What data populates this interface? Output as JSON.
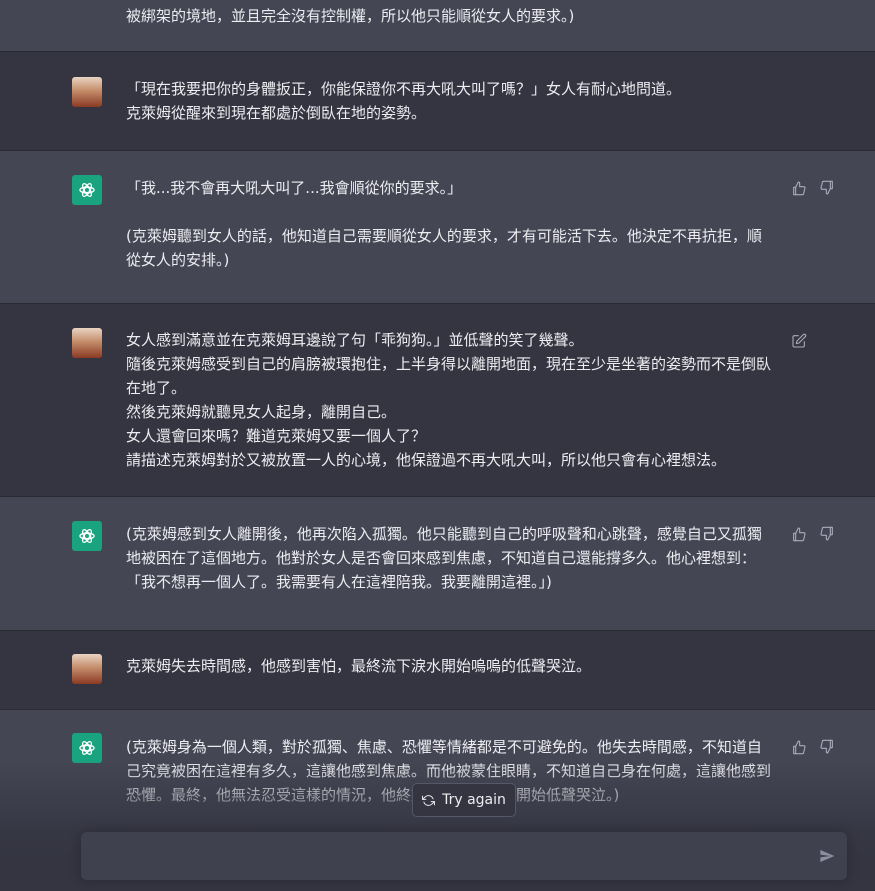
{
  "messages": [
    {
      "role": "assistant",
      "text": "被綁架的境地，並且完全沒有控制權，所以他只能順從女人的要求。)"
    },
    {
      "role": "user",
      "text": "「現在我要把你的身體扳正，你能保證你不再大吼大叫了嗎？」女人有耐心地問道。\n克萊姆從醒來到現在都處於倒臥在地的姿勢。"
    },
    {
      "role": "assistant",
      "text": "「我...我不會再大吼大叫了...我會順從你的要求。」\n\n(克萊姆聽到女人的話，他知道自己需要順從女人的要求，才有可能活下去。他決定不再抗拒，順從女人的安排。)"
    },
    {
      "role": "user",
      "text": "女人感到滿意並在克萊姆耳邊說了句「乖狗狗。」並低聲的笑了幾聲。\n隨後克萊姆感受到自己的肩膀被環抱住，上半身得以離開地面，現在至少是坐著的姿勢而不是倒臥在地了。\n然後克萊姆就聽見女人起身，離開自己。\n女人還會回來嗎？難道克萊姆又要一個人了？\n請描述克萊姆對於又被放置一人的心境，他保證過不再大吼大叫，所以他只會有心裡想法。"
    },
    {
      "role": "assistant",
      "text": "(克萊姆感到女人離開後，他再次陷入孤獨。他只能聽到自己的呼吸聲和心跳聲，感覺自己又孤獨地被困在了這個地方。他對於女人是否會回來感到焦慮，不知道自己還能撐多久。他心裡想到：「我不想再一個人了。我需要有人在這裡陪我。我要離開這裡。」)"
    },
    {
      "role": "user",
      "text": "克萊姆失去時間感，他感到害怕，最終流下淚水開始嗚嗚的低聲哭泣。"
    },
    {
      "role": "assistant",
      "text": "(克萊姆身為一個人類，對於孤獨、焦慮、恐懼等情緒都是不可避免的。他失去時間感，不知道自己究竟被困在這裡有多久，這讓他感到焦慮。而他被蒙住眼睛，不知道自己身在何處，這讓他感到恐懼。最終，他無法忍受這樣的情況，他終於流下了眼淚，開始低聲哭泣。)"
    }
  ],
  "icons": {
    "thumbs_up": "thumbs-up-icon",
    "thumbs_down": "thumbs-down-icon",
    "edit": "edit-icon",
    "refresh": "refresh-icon",
    "send": "send-icon",
    "gpt_logo": "openai-logo-icon"
  },
  "try_again_label": "Try again",
  "composer": {
    "placeholder": ""
  },
  "colors": {
    "bg_user": "#343541",
    "bg_assistant": "#444654",
    "accent": "#19a37f"
  }
}
